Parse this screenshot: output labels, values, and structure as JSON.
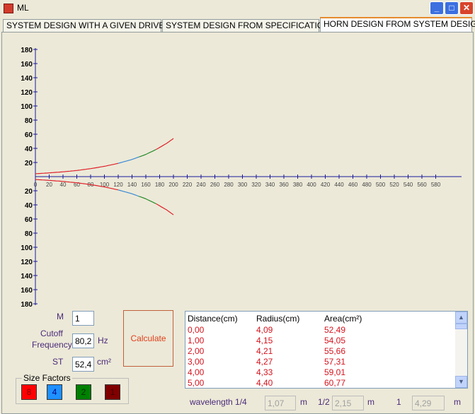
{
  "window": {
    "title": "ML"
  },
  "tabs": [
    {
      "label": "SYSTEM DESIGN WITH A GIVEN DRIVER"
    },
    {
      "label": "SYSTEM DESIGN FROM SPECIFICATIONS"
    },
    {
      "label": "HORN DESIGN FROM SYSTEM DESIGN"
    }
  ],
  "active_tab": 2,
  "chart_data": {
    "type": "line",
    "y_ticks_top": [
      "180",
      "160",
      "140",
      "120",
      "100",
      "80",
      "60",
      "40",
      "20"
    ],
    "y_ticks_bottom": [
      "20",
      "40",
      "60",
      "80",
      "100",
      "120",
      "140",
      "160",
      "180"
    ],
    "x_ticks": [
      "0",
      "20",
      "40",
      "60",
      "80",
      "100",
      "120",
      "140",
      "160",
      "180",
      "200",
      "220",
      "240",
      "260",
      "280",
      "300",
      "320",
      "340",
      "360",
      "380",
      "400",
      "420",
      "440",
      "460",
      "480",
      "500",
      "520",
      "540",
      "560",
      "580"
    ],
    "xlim": [
      0,
      590
    ],
    "ylim": [
      -180,
      180
    ],
    "segment_colors": [
      "#e0202a",
      "#3a8ad6",
      "#2a8c2a",
      "#e0202a"
    ],
    "segment_breaks": [
      0,
      120,
      150,
      175,
      200
    ],
    "series": [
      {
        "x": [
          0,
          20,
          40,
          60,
          80,
          100,
          120,
          140,
          160,
          175,
          190,
          200
        ],
        "y": [
          4.09,
          5.3,
          6.8,
          8.7,
          11.3,
          14.6,
          18.8,
          24.3,
          31.4,
          38.5,
          47,
          54
        ]
      }
    ]
  },
  "inputs": {
    "m_label": "M",
    "m_value": "1",
    "cutoff_label_1": "Cutoff",
    "cutoff_label_2": "Frequency",
    "cutoff_value": "80,2",
    "cutoff_unit": "Hz",
    "st_label": "ST",
    "st_value": "52,4",
    "st_unit": "cm²"
  },
  "calculate_label": "Calculate",
  "size_factors": {
    "title": "Size Factors",
    "items": [
      {
        "label": "8",
        "color": "#ff0000",
        "text": "#800000"
      },
      {
        "label": "4",
        "color": "#1e90ff",
        "text": "#000080"
      },
      {
        "label": "2",
        "color": "#008000",
        "text": "#003000"
      },
      {
        "label": "1",
        "color": "#800000",
        "text": "#400000"
      }
    ]
  },
  "table": {
    "headers": [
      "Distance(cm)",
      "Radius(cm)",
      "Area(cm²)"
    ],
    "rows": [
      [
        "0,00",
        "4,09",
        "52,49"
      ],
      [
        "1,00",
        "4,15",
        "54,05"
      ],
      [
        "2,00",
        "4,21",
        "55,66"
      ],
      [
        "3,00",
        "4,27",
        "57,31"
      ],
      [
        "4,00",
        "4,33",
        "59,01"
      ],
      [
        "5,00",
        "4,40",
        "60,77"
      ]
    ]
  },
  "wavelength": {
    "label": "wavelength 1/4",
    "quarter_value": "1,07",
    "quarter_unit": "m",
    "half_label": "1/2",
    "half_value": "2,15",
    "half_unit": "m",
    "full_label": "1",
    "full_value": "4,29",
    "full_unit": "m"
  }
}
